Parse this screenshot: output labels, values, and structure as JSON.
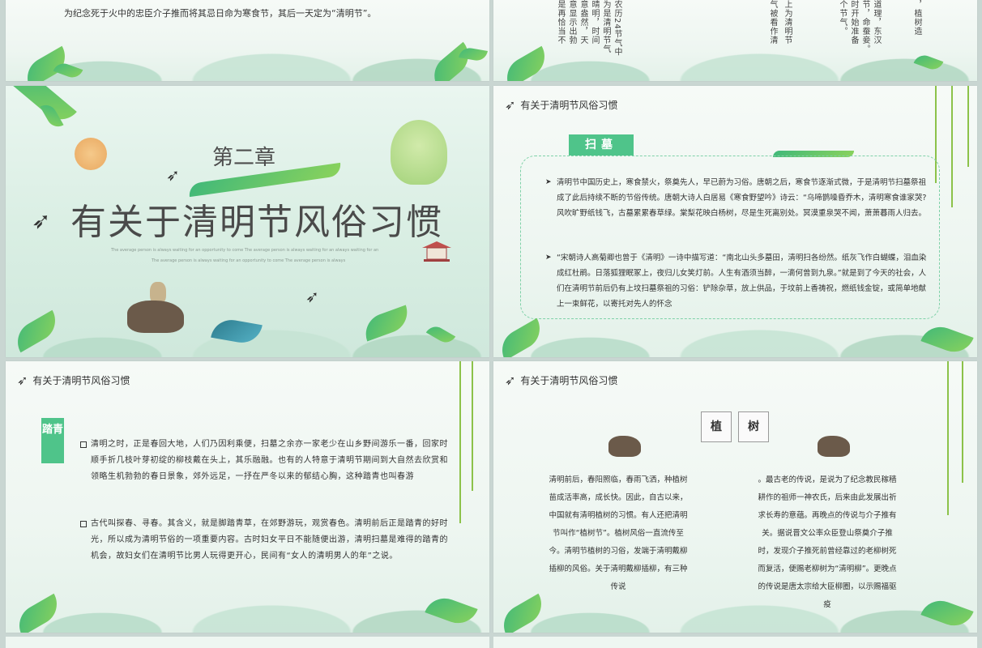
{
  "slide1": {
    "text": "为纪念死于火中的忠臣介子推而将其忌日命为寒食节，其后一天定为“清明节”。"
  },
  "slide2": {
    "columns": [
      "是再恰当不",
      "意显示出勃",
      "意盎然，天",
      "晴明，时间",
      "为是清明节气",
      "农历24节气中",
      "气被看作清",
      "上为清明节",
      "个节气。",
      "时开始准备",
      "节，命蚕妾。",
      "道理，东汉",
      "，植树造"
    ]
  },
  "slide3": {
    "chapter": "第二章",
    "title": "有关于清明节风俗习惯",
    "sub1": "The average person is always waiting for an opportunity to come The average person is always waiting for an always waiting for an",
    "sub2": "The average person is always waiting for an opportunity to come The average person is always"
  },
  "slide4": {
    "header": "有关于清明节风俗习惯",
    "tag": "扫墓",
    "para1": "清明节中国历史上，寒食禁火，祭奠先人，早已蔚为习俗。唐朝之后，寒食节逐渐式微，于是清明节扫墓祭祖成了此后持续不断的节俗传统。唐朝大诗人白居易《寒食野望吟》诗云：“乌啼鹊噪昏乔木，清明寒食谁家哭?风吹旷野纸钱飞，古墓累累春草绿。棠梨花映白杨树，尽是生死离别处。冥漠重泉哭不闻，萧萧暮雨人归去。",
    "para2": "“宋朝诗人高菊卿也曾于《清明》一诗中描写道：“南北山头多墓田，清明扫各纷然。纸灰飞作白蝴蝶，泪血染成红杜鹃。日落狐狸眠冢上，夜归儿女笑灯前。人生有酒须当醉，一滴何曾到九泉。”就是到了今天的社会，人们在清明节前后仍有上坟扫墓祭祖的习俗：铲除杂草，放上供品，于坟前上香祷祝，燃纸钱金锭，或简单地献上一束鲜花，以寄托对先人的怀念"
  },
  "slide5": {
    "header": "有关于清明节风俗习惯",
    "tag": "踏青",
    "para1": "清明之时，正是春回大地，人们乃因利乘便，扫墓之余亦一家老少在山乡野间游乐一番，回家时顺手折几枝叶芽初绽的柳枝戴在头上，其乐融融。也有的人特意于清明节期间到大自然去欣赏和领略生机勃勃的春日景象，郊外远足，一抒在严冬以来的郁结心胸，这种踏青也叫春游",
    "para2": "古代叫探春、寻春。其含义，就是脚踏青草，在郊野游玩，观赏春色。清明前后正是踏青的好时光，所以成为清明节俗的一项重要内容。古时妇女平日不能随便出游，清明扫墓是难得的踏青的机会，故妇女们在清明节比男人玩得更开心，民间有“女人的清明男人的年”之说。"
  },
  "slide6": {
    "header": "有关于清明节风俗习惯",
    "char1": "植",
    "char2": "树",
    "left": "清明前后，春阳照临，春雨飞洒，种植树苗成活率高，成长快。因此，自古以来，中国就有清明植树的习惯。有人还把清明节叫作“植树节”。植树风俗一直流传至今。清明节植树的习俗，发端于清明戴柳插柳的风俗。关于清明戴柳插柳，有三种传说",
    "right": "。最古老的传说，是说为了纪念教民稼穑耕作的祖师一神农氏，后来由此发展出祈求长寿的意蕴。再晚点的传说与介子推有关。据说晋文公率众臣登山祭奠介子推时，发现介子推死前曾经靠过的老柳树死而复活，便赐老柳树为“清明柳”。更晚点的传说是唐太宗给大臣柳圈，以示赐福驱疫"
  },
  "colors": {
    "accent": "#4fc48a",
    "text": "#333333",
    "border": "#7fd1a8"
  }
}
